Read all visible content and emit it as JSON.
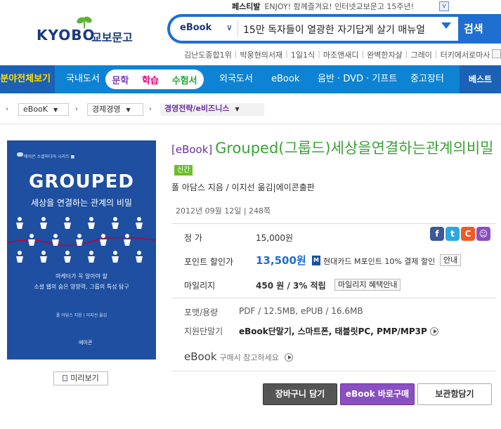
{
  "top": {
    "festival_label": "페스티발",
    "festival_text": "ENJOY! 함께즐겨요! 인터넷교보문고 15주년!",
    "corner_icon": "v"
  },
  "logo": {
    "word": "KYOBO",
    "kr": "교보문고"
  },
  "search": {
    "category": "eBook",
    "query": "15만 독자들이 열광한 자기답게 살기 매뉴얼",
    "button": "검색"
  },
  "hotwords": [
    "김난도종합1위",
    "박웅현의서재",
    "1일1식",
    "마조앤새디",
    "완벽한자살",
    "그레이",
    "터키에서로마사"
  ],
  "nav": {
    "all": "분야전체보기",
    "domestic": "국내도서",
    "pill": [
      "문학",
      "학습",
      "수험서"
    ],
    "foreign": "외국도서",
    "ebook": "eBook",
    "music": "음반 · DVD · 기프트",
    "used": "중고장터",
    "best": "베스트"
  },
  "breadcrumb": [
    "eBooK",
    "경제경영",
    "경영전략/e비즈니스"
  ],
  "cover": {
    "series": "에이콘 소셜미디어 시리즈 ■",
    "title": "GROUPED",
    "subtitle": "세상을 연결하는 관계의 비밀",
    "tagline1": "마케터가 꼭 알아야 할",
    "tagline2": "소셜 웹의 숨은 영향력, 그룹의 특성 탐구",
    "author": "폴 아담스 지음 | 이지선 옮김",
    "publisher": "에이콘"
  },
  "preview_button": "미리보기",
  "book": {
    "tag": "[eBook]",
    "title": "Grouped(그룹드)세상을연결하는관계의비밀",
    "new_badge": "신간",
    "authors": "폴 아담스 지음 / 이지선 옮김|에이콘출판",
    "date": "2012년 09월 12일 | 248쪽"
  },
  "price": {
    "list_label": "정      가",
    "list_value": "15,000원",
    "sale_label": "포인트 할인가",
    "sale_value": "13,500원",
    "card_icon": "M",
    "card_text": "현대카드 M포인트 10% 결제 할인",
    "card_btn": "안내",
    "mileage_label": "마일리지",
    "mileage_value": "450 원 / 3% 적립",
    "mileage_btn": "마일리지 혜택안내"
  },
  "sns": [
    {
      "name": "facebook-icon",
      "glyph": "f",
      "color": "#3b5998"
    },
    {
      "name": "twitter-icon",
      "glyph": "t",
      "color": "#2aa9e0"
    },
    {
      "name": "cyworld-icon",
      "glyph": "C",
      "color": "#f05a28"
    },
    {
      "name": "me2day-icon",
      "glyph": "☺",
      "color": "#8a4fc1"
    }
  ],
  "info": {
    "format_label": "포맷/용량",
    "format_value": "PDF / 12.5MB, ePUB / 16.6MB",
    "device_label": "지원단말기",
    "device_value": "eBook단말기, 스마트폰, 태블릿PC, PMP/MP3P",
    "ebook_word": "eBook",
    "ebook_note": "구매시 참고하세요"
  },
  "actions": {
    "cart": "장바구니 담기",
    "buy": "eBook 바로구매",
    "keep": "보관함담기"
  }
}
